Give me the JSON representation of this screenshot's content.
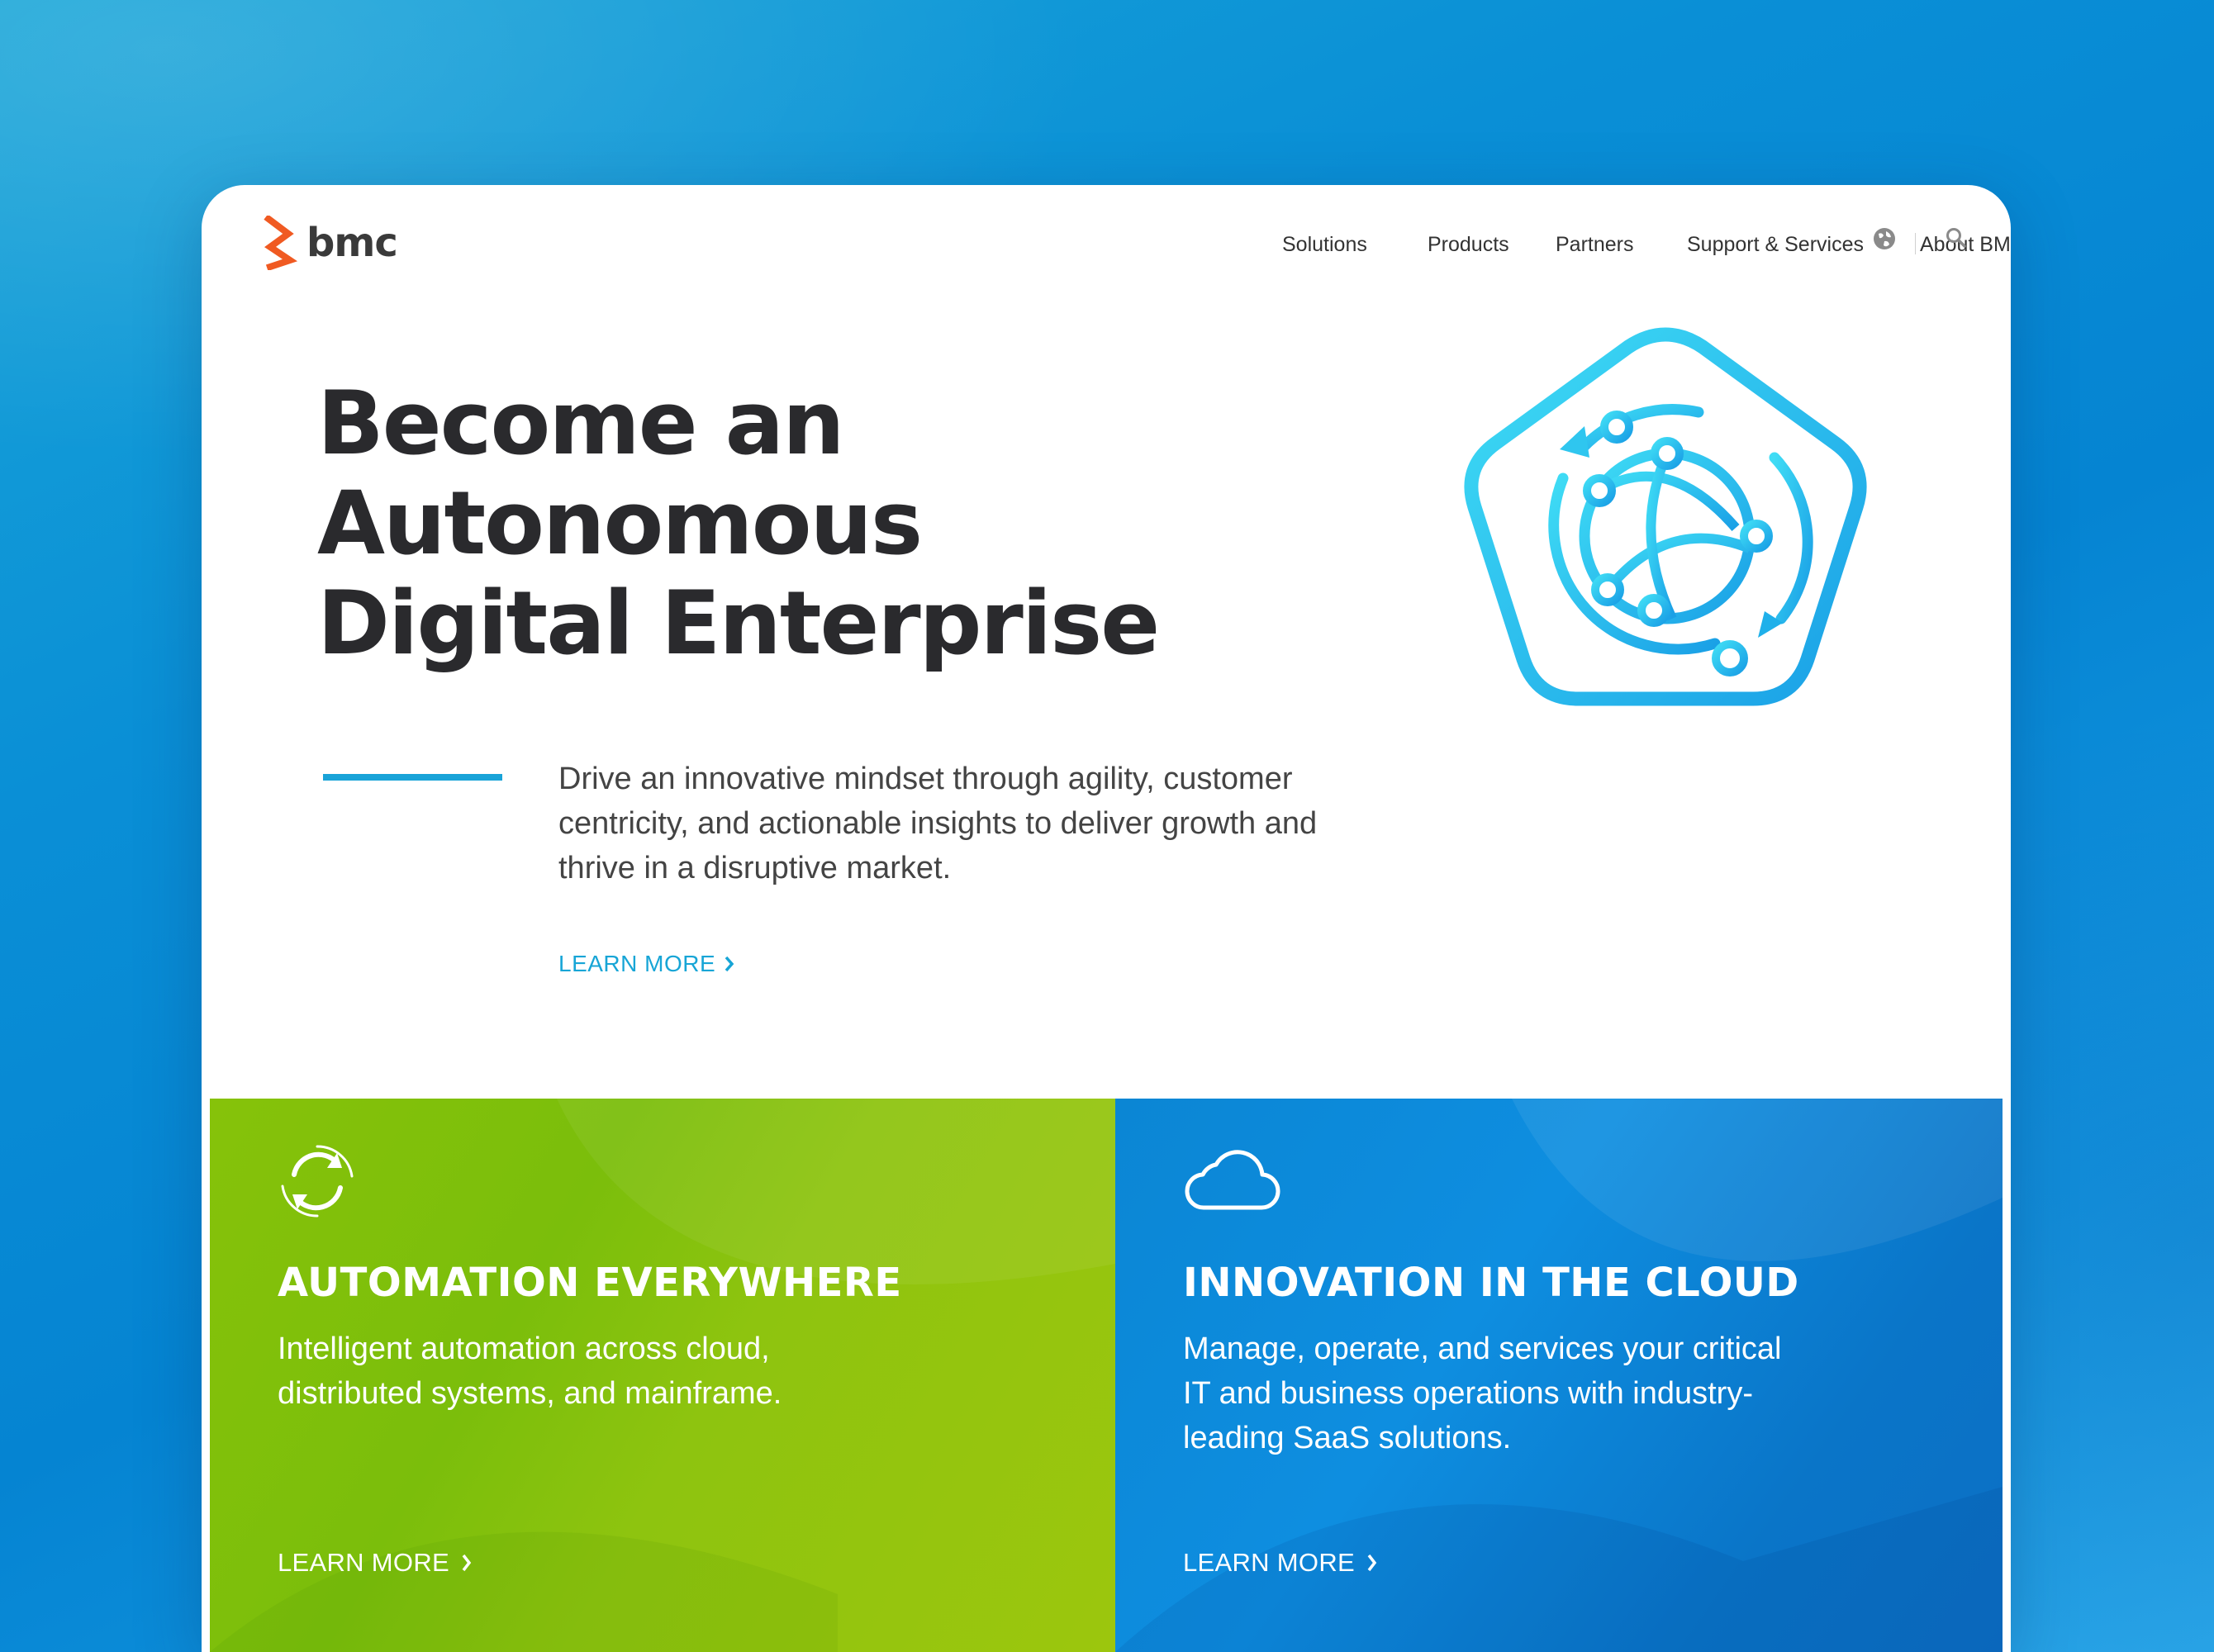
{
  "brand": {
    "logo_text": "bmc",
    "logo_color": "#f05a22"
  },
  "nav": {
    "items": [
      {
        "label": "Solutions"
      },
      {
        "label": "Products"
      },
      {
        "label": "Partners"
      },
      {
        "label": "Support & Services"
      },
      {
        "label": "About BMC"
      }
    ],
    "icons": [
      "globe-icon",
      "search-icon"
    ]
  },
  "hero": {
    "title_line1": "Become an",
    "title_line2": "Autonomous",
    "title_line3": "Digital Enterprise",
    "description": "Drive an innovative mindset through agility, customer centricity, and actionable insights to deliver growth and thrive in a disruptive market.",
    "cta": "LEARN MORE",
    "accent_color": "#19a3d8",
    "illustration": "pentagon-network-globe-icon"
  },
  "tiles": [
    {
      "icon": "refresh-cycle-icon",
      "title": "AUTOMATION EVERYWHERE",
      "description": "Intelligent automation across cloud, distributed systems, and mainframe.",
      "cta": "LEARN MORE",
      "color": "#82c00b"
    },
    {
      "icon": "cloud-icon",
      "title": "INNOVATION IN THE CLOUD",
      "description": "Manage, operate, and services your critical IT and business operations with industry-leading SaaS solutions.",
      "cta": "LEARN MORE",
      "color": "#0b86d4"
    }
  ]
}
